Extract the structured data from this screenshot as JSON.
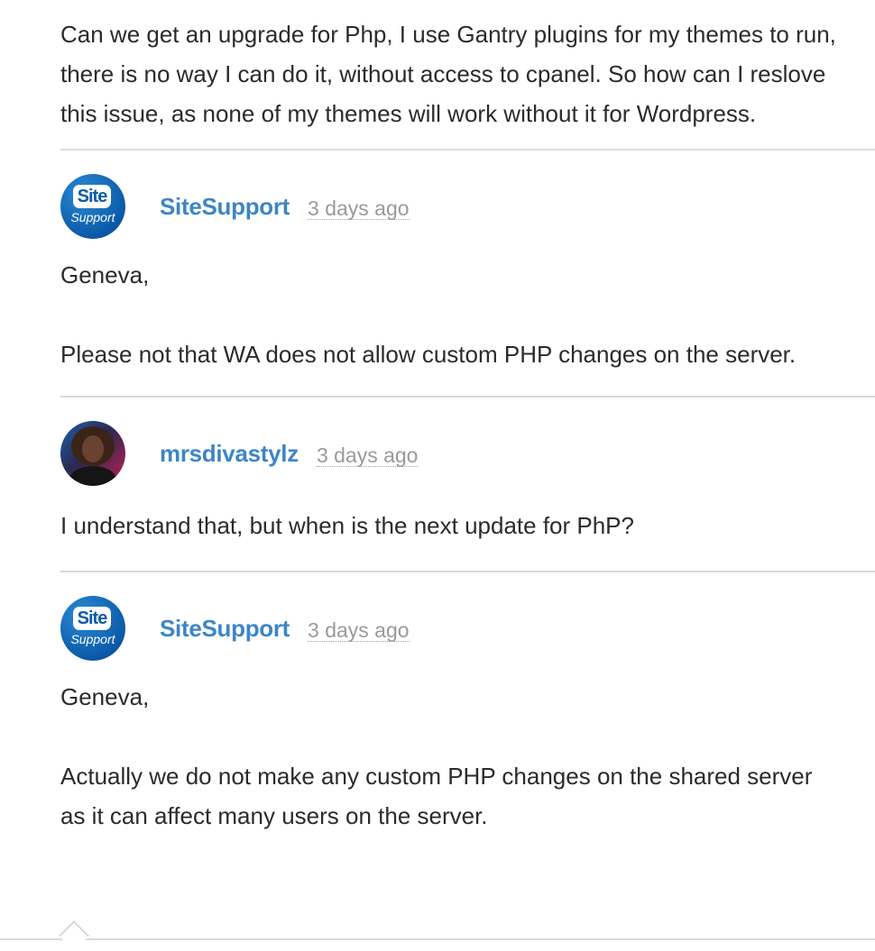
{
  "original_post": {
    "text": "Can we get an upgrade for Php, I use Gantry plugins for my themes to run, there is no way I can do it, without access to cpanel. So how can I reslove this issue, as none of my themes will work without it for Wordpress."
  },
  "replies": [
    {
      "author": "SiteSupport",
      "time": "3 days ago",
      "avatar": {
        "logo_top": "Site",
        "logo_bottom": "Support"
      },
      "paragraphs": [
        "Geneva,",
        "Please not that WA does not allow custom PHP changes on the server."
      ]
    },
    {
      "author": "mrsdivastylz",
      "time": "3 days ago",
      "avatar": {
        "type": "user-photo"
      },
      "paragraphs": [
        "I understand that, but when is the next update for PhP?"
      ]
    },
    {
      "author": "SiteSupport",
      "time": "3 days ago",
      "avatar": {
        "logo_top": "Site",
        "logo_bottom": "Support"
      },
      "paragraphs": [
        "Geneva,",
        "Actually we do not make any custom PHP changes on the shared server as it can affect many users on the server."
      ]
    }
  ],
  "colors": {
    "author_link": "#3d85c6",
    "timestamp": "#9a9a9a",
    "divider": "#d9d9d9",
    "text": "#2b2b2b"
  }
}
